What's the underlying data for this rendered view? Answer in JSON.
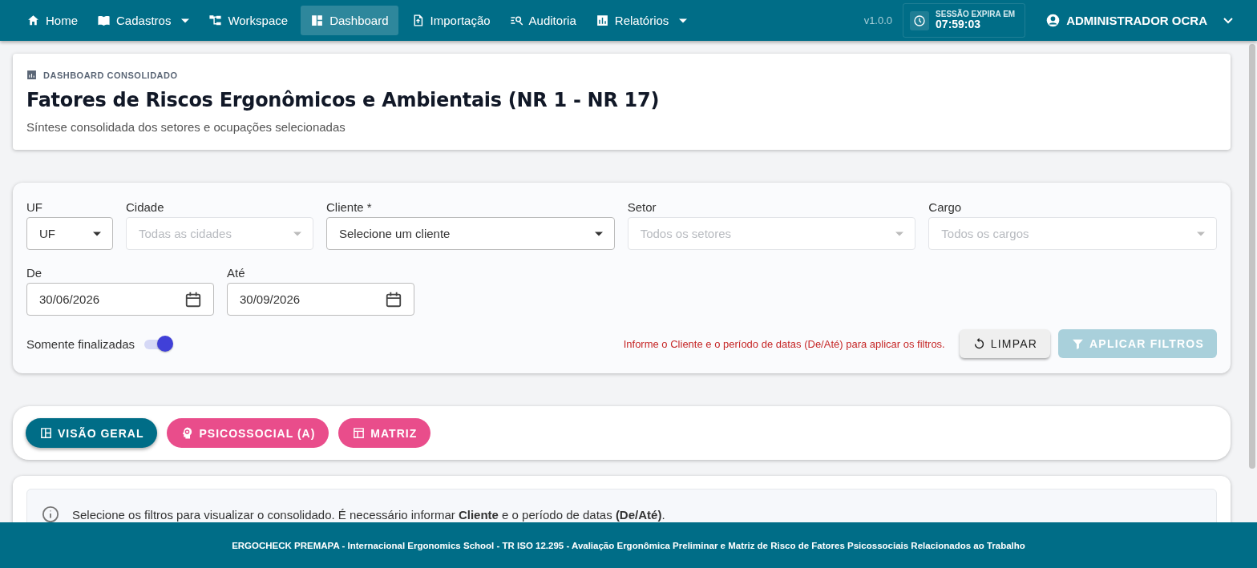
{
  "nav": {
    "items": [
      {
        "label": "Home",
        "dropdown": false,
        "selected": false
      },
      {
        "label": "Cadastros",
        "dropdown": true,
        "selected": false
      },
      {
        "label": "Workspace",
        "dropdown": false,
        "selected": false
      },
      {
        "label": "Dashboard",
        "dropdown": false,
        "selected": true
      },
      {
        "label": "Importação",
        "dropdown": false,
        "selected": false
      },
      {
        "label": "Auditoria",
        "dropdown": false,
        "selected": false
      },
      {
        "label": "Relatórios",
        "dropdown": true,
        "selected": false
      }
    ],
    "version": "v1.0.0",
    "session": {
      "label": "SESSÃO EXPIRA EM",
      "time": "07:59:03"
    },
    "user": "ADMINISTRADOR OCRA"
  },
  "header_card": {
    "eyebrow": "DASHBOARD CONSOLIDADO",
    "title": "Fatores de Riscos Ergonômicos e Ambientais (NR 1 - NR 17)",
    "subtitle": "Síntese consolidada dos setores e ocupações selecionadas"
  },
  "filters": {
    "fields": [
      {
        "label": "UF",
        "kind": "select",
        "value": "UF",
        "disabled": false
      },
      {
        "label": "Cidade",
        "kind": "select",
        "placeholder": "Todas as cidades",
        "disabled": true
      },
      {
        "label": "Cliente *",
        "kind": "select",
        "value": "Selecione um cliente",
        "disabled": false
      },
      {
        "label": "Setor",
        "kind": "select",
        "placeholder": "Todos os setores",
        "disabled": true
      },
      {
        "label": "Cargo",
        "kind": "select",
        "placeholder": "Todos os cargos",
        "disabled": true
      },
      {
        "label": "De",
        "kind": "date",
        "value": "30/06/2026",
        "disabled": false
      },
      {
        "label": "Até",
        "kind": "date",
        "value": "30/09/2026",
        "disabled": false
      }
    ],
    "toggle": {
      "label": "Somente finalizadas",
      "on": true
    },
    "warning": "Informe o Cliente e o período de datas (De/Até) para aplicar os filtros.",
    "buttons": [
      {
        "label": "LIMPAR",
        "disabled": false
      },
      {
        "label": "APLICAR FILTROS",
        "disabled": true
      }
    ]
  },
  "tabs": [
    {
      "label": "VISÃO GERAL",
      "selected": true
    },
    {
      "label": "PSICOSSOCIAL (A)",
      "selected": false
    },
    {
      "label": "MATRIZ",
      "selected": false
    }
  ],
  "alert": {
    "text": "Selecione os filtros para visualizar o consolidado. É necessário informar **Cliente** e o período de datas **(De/Até)**."
  },
  "footer": "ERGOCHECK PREMAPA - Internacional Ergonomics School - TR ISO 12.295 - Avaliação Ergonômica Preliminar e Matriz de Risco de Fatores Psicossociais Relacionados ao Trabalho"
}
